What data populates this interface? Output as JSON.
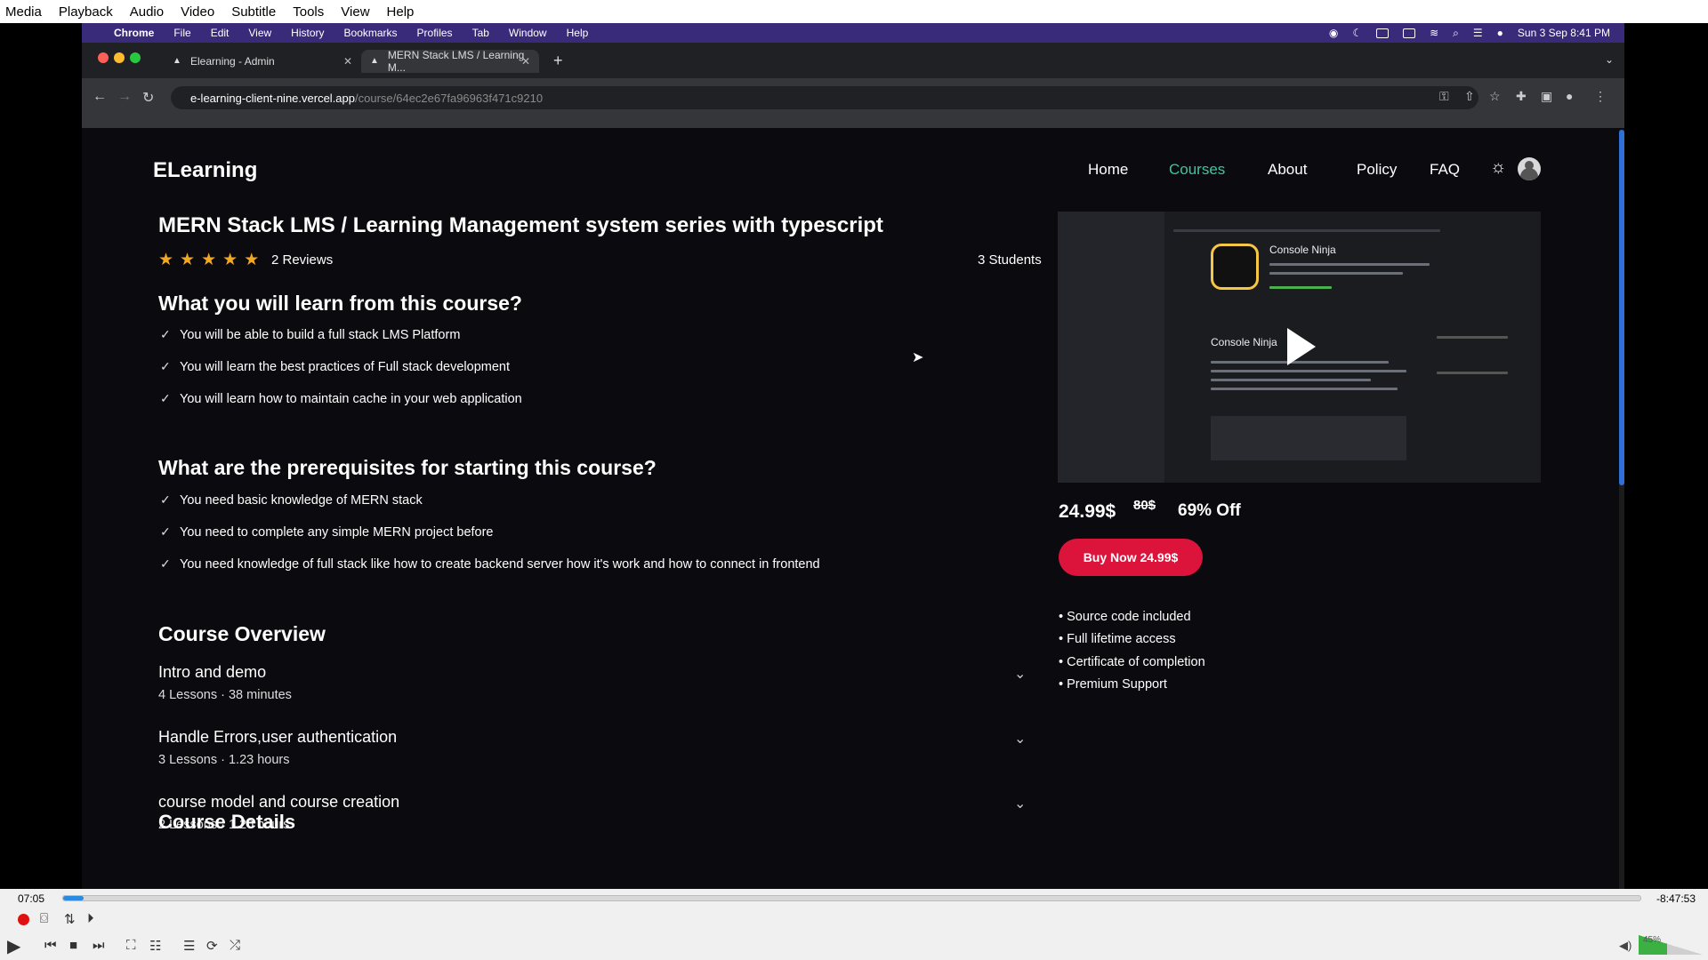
{
  "vlc_menu": [
    "Media",
    "Playback",
    "Audio",
    "Video",
    "Subtitle",
    "Tools",
    "View",
    "Help"
  ],
  "mac_menu": {
    "app": "Chrome",
    "items": [
      "File",
      "Edit",
      "View",
      "History",
      "Bookmarks",
      "Profiles",
      "Tab",
      "Window",
      "Help"
    ],
    "datetime": "Sun 3 Sep  8:41 PM"
  },
  "browser": {
    "tabs": [
      {
        "title": "Elearning - Admin"
      },
      {
        "title": "MERN Stack LMS / Learning M..."
      }
    ],
    "url_domain": "e-learning-client-nine.vercel.app",
    "url_path": "/course/64ec2e67fa96963f471c9210"
  },
  "site": {
    "logo": "ELearning",
    "nav": [
      "Home",
      "Courses",
      "About",
      "Policy",
      "FAQ"
    ],
    "active_nav": "Courses",
    "course_title": "MERN Stack LMS / Learning Management system series with typescript",
    "rating_stars": 5,
    "reviews": "2 Reviews",
    "students": "3 Students",
    "learn_heading": "What you will learn from this course?",
    "learn_items": [
      "You will be able to build a full stack LMS Platform",
      "You will learn the best practices of Full stack development",
      "You will learn how to maintain cache in your web application"
    ],
    "prereq_heading": "What are the prerequisites for starting this course?",
    "prereq_items": [
      "You need basic knowledge of MERN stack",
      "You need to complete any simple MERN project before",
      "You need knowledge of full stack like how to create backend server how it's work and how to connect in frontend"
    ],
    "overview_heading": "Course Overview",
    "sections": [
      {
        "title": "Intro and demo",
        "meta": "4 Lessons · 38 minutes"
      },
      {
        "title": "Handle Errors,user authentication",
        "meta": "3 Lessons · 1.23 hours"
      },
      {
        "title": "course model and course creation",
        "meta": "2 Lessons · 1.20 hours"
      }
    ],
    "details_heading": "Course Details",
    "video": {
      "app_name": "Console Ninja",
      "title": "Console Ninja"
    },
    "price": "24.99$",
    "old_price": "80$",
    "discount": "69% Off",
    "buy_button": "Buy Now 24.99$",
    "features": [
      "• Source code included",
      "• Full lifetime access",
      "• Certificate of completion",
      "• Premium Support"
    ]
  },
  "player": {
    "time_current": "07:05",
    "time_remaining": "-8:47:53",
    "progress": 0.013,
    "volume": "45%",
    "volume_level": 0.45
  }
}
